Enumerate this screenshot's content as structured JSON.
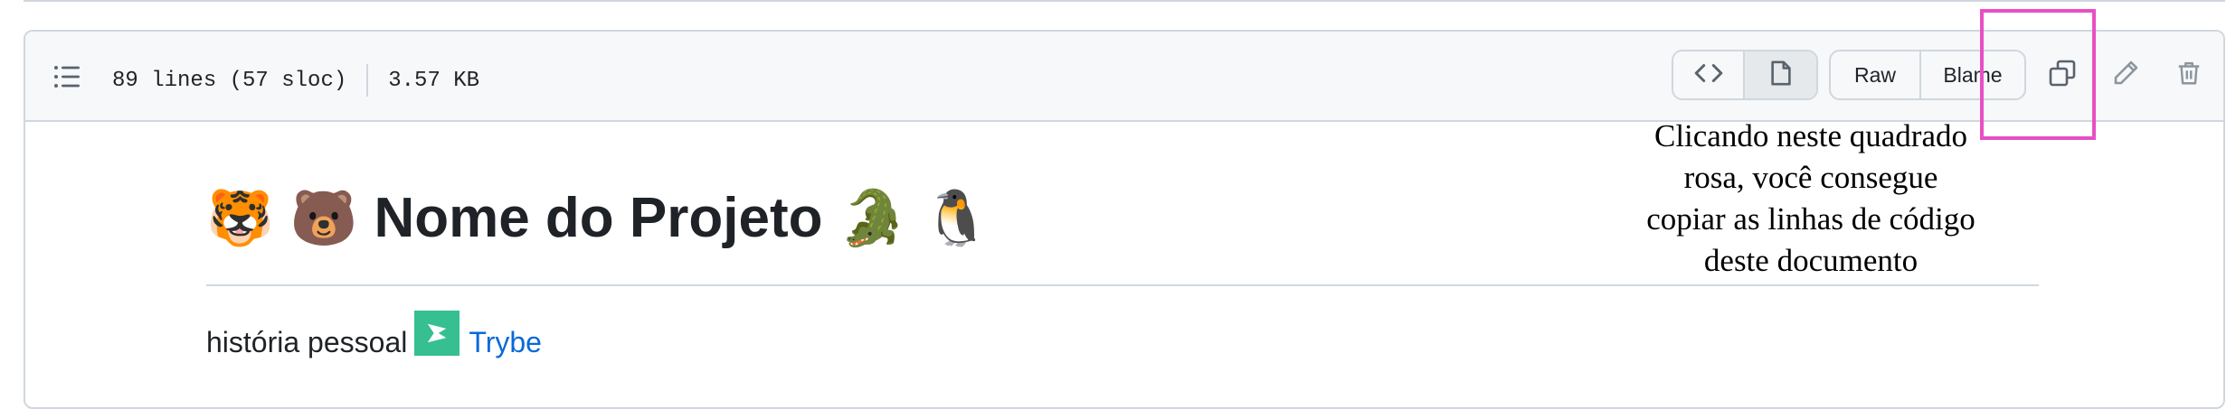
{
  "header": {
    "lines_info": "89 lines (57 sloc)",
    "size_info": "3.57 KB",
    "raw_label": "Raw",
    "blame_label": "Blame"
  },
  "annotation": {
    "text_line1": "Clicando neste quadrado",
    "text_line2": "rosa, você consegue",
    "text_line3": "copiar as linhas de código",
    "text_line4": "deste documento",
    "highlight_color": "#e84fc4"
  },
  "readme": {
    "title_emoji_1": "🐯",
    "title_emoji_2": "🐻",
    "title_text": "Nome do Projeto",
    "title_emoji_3": "🐊",
    "title_emoji_4": "🐧",
    "line_text": "história pessoal",
    "link_text": "Trybe"
  },
  "icons": {
    "outline": "list-icon",
    "code_view": "code-icon",
    "preview_view": "file-icon",
    "copy": "copy-icon",
    "edit": "pencil-icon",
    "delete": "trash-icon",
    "brand": "trybe-logo"
  },
  "colors": {
    "link": "#0969da",
    "border": "#d0d7de",
    "header_bg": "#f6f8fa",
    "trybe_green": "#36bf91"
  }
}
